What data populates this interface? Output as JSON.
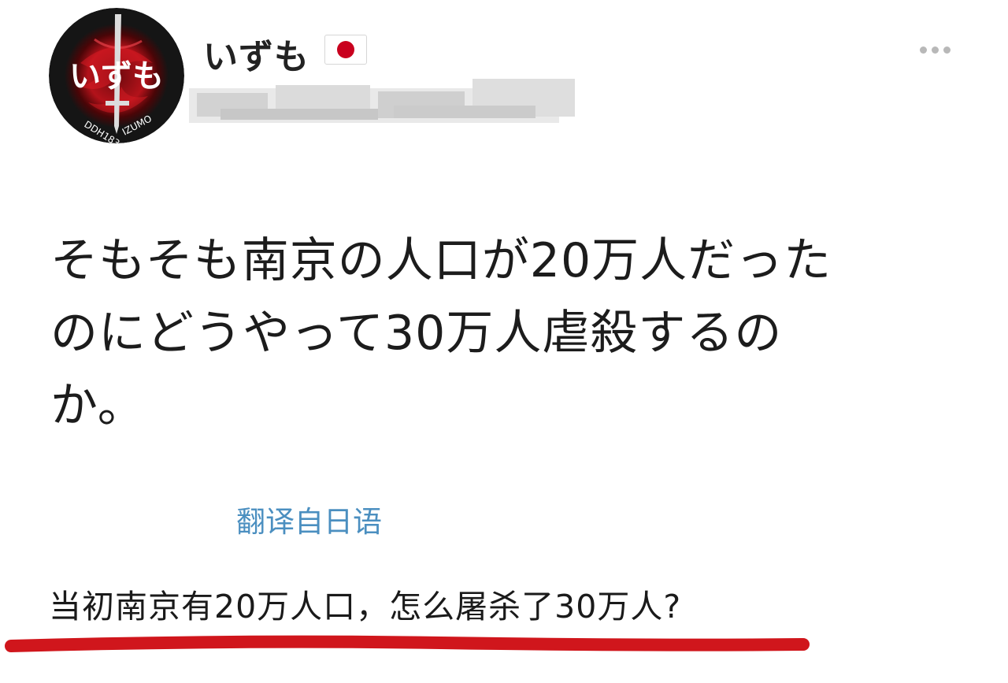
{
  "user": {
    "display_name": "いずも",
    "flag_icon": "japan-flag-icon",
    "avatar": {
      "main_text": "いずも",
      "ring_text_left": "DDH183",
      "ring_text_right": "IZUMO",
      "colors": {
        "dark": "#151515",
        "accent": "#b3121a"
      }
    }
  },
  "menu": {
    "icon": "more-dots-icon"
  },
  "post": {
    "text_lines": [
      "そもそも南京の人口が20万人だった",
      "のにどうやって30万人虐殺するの",
      "か。"
    ]
  },
  "translate_link": "翻译自日语",
  "translation": "当初南京有20万人口，怎么屠杀了30万人?",
  "colors": {
    "link": "#4b8fc0",
    "highlight_stroke": "#d0161c",
    "text": "#1c1c1c"
  }
}
